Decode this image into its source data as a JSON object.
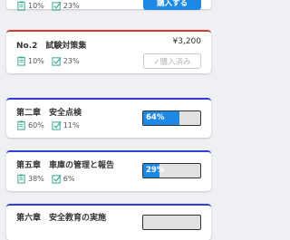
{
  "accent_blue": "#1e88e5",
  "accent_red": "#d5392f",
  "cards": [
    {
      "stat1_icon": "clipboard-icon",
      "stat1": "10%",
      "stat2_icon": "checkbox-icon",
      "stat2": "23%",
      "button_label": "購入する"
    },
    {
      "title": "No.2　試験対策集",
      "price": "¥3,200",
      "stat1": "10%",
      "stat2": "23%",
      "button_label": "✓購入済み"
    },
    {
      "title": "第二章　安全点検",
      "stat1": "60%",
      "stat2": "11%",
      "progress": 64,
      "progress_label": "64%"
    },
    {
      "title": "第五章　車庫の管理と報告",
      "stat1": "38%",
      "stat2": "6%",
      "progress": 29,
      "progress_label": "29%"
    },
    {
      "title": "第六章　安全教育の実施"
    }
  ]
}
